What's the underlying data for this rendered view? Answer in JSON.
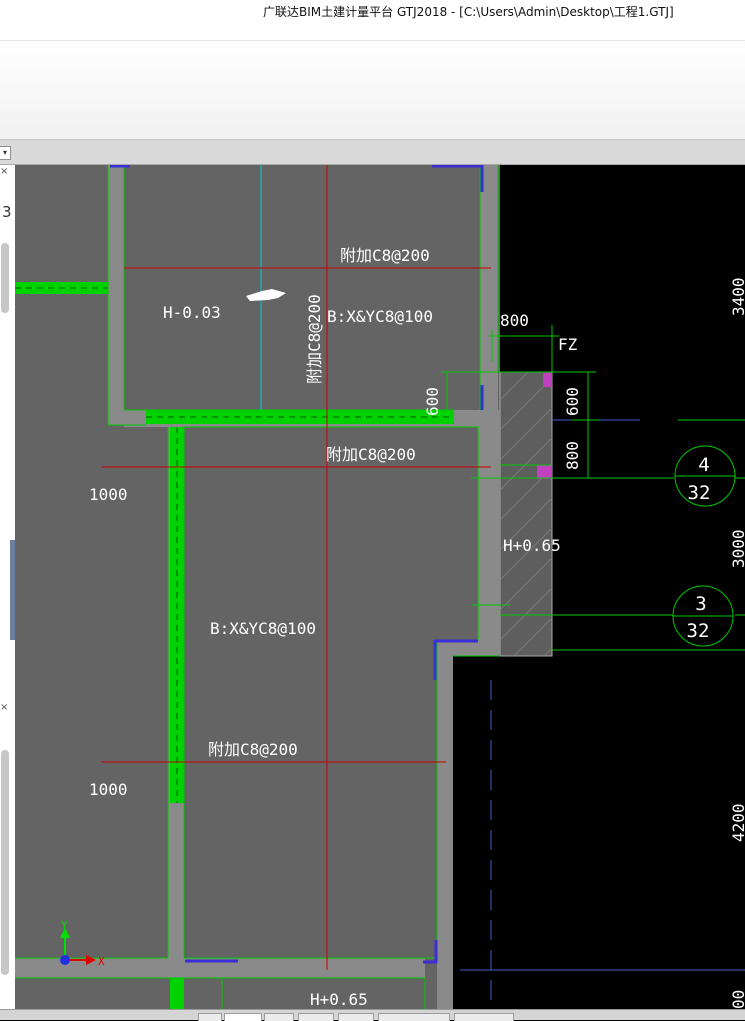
{
  "window": {
    "title": "广联达BIM土建计量平台 GTJ2018 - [C:\\Users\\Admin\\Desktop\\工程1.GTJ]"
  },
  "left_panel": {
    "visible_number": "3",
    "close_symbol": "×"
  },
  "drawing": {
    "texts": {
      "rebar_top": "附加C8@200",
      "rebar_mid": "附加C8@200",
      "rebar_low": "附加C8@200",
      "rebar_vertical": "附加C8@200",
      "slab_upper": "B:X&YC8@100",
      "slab_lower": "B:X&YC8@100",
      "elev_room": "H-0.03",
      "elev_balcony": "H+0.65",
      "elev_bottom": "H+0.65",
      "dim_1000_upper": "1000",
      "dim_1000_lower": "1000",
      "dim_800_top": "800",
      "dim_600_vert": "600",
      "dim_600_right": "600",
      "dim_800_right": "800",
      "fz_label": "FZ",
      "dim_3400": "3400",
      "dim_3000": "3000",
      "dim_4200": "4200",
      "dim_bottom_right": "00",
      "axis_4_top": "4",
      "axis_4_bottom": "32",
      "axis_3_top": "3",
      "axis_3_bottom": "32",
      "ucs_y": "Y",
      "ucs_x": "X"
    },
    "colors": {
      "slab_fill": "#646464",
      "wall_green": "#00d200",
      "rebar_line": "#c80000",
      "axis_green": "#00c800",
      "wall_edge_blue": "#3a2fd6",
      "canvas_bg": "#000000"
    }
  }
}
